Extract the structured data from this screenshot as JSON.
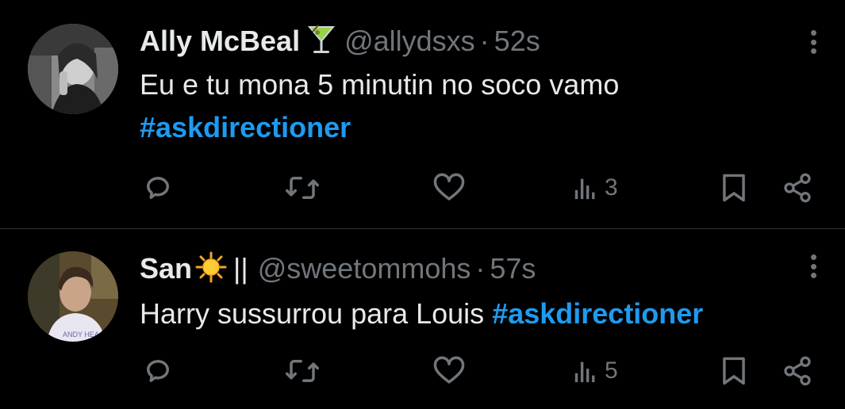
{
  "tweets": [
    {
      "display_name": "Ally McBeal",
      "name_emoji": "cocktail-glass-emoji",
      "handle": "@allydsxs",
      "separator": "·",
      "time": "52s",
      "text": "Eu e tu mona 5 minutin no soco vamo",
      "hashtag": "#askdirectioner",
      "views": "3",
      "avatar": "grayscale-portrait-photo"
    },
    {
      "display_name": "San",
      "name_emoji": "sun-emoji",
      "name_suffix": "||",
      "handle": "@sweetommohs",
      "separator": "·",
      "time": "57s",
      "text": "Harry sussurrou para Louis ",
      "hashtag": "#askdirectioner",
      "views": "5",
      "avatar": "color-portrait-photo"
    }
  ],
  "colors": {
    "background": "#000000",
    "text": "#e7e9ea",
    "muted": "#71767b",
    "link": "#1d9bf0",
    "divider": "#2f3336"
  },
  "icons": [
    "reply-icon",
    "retweet-icon",
    "like-icon",
    "views-icon",
    "bookmark-icon",
    "share-icon",
    "more-icon"
  ]
}
